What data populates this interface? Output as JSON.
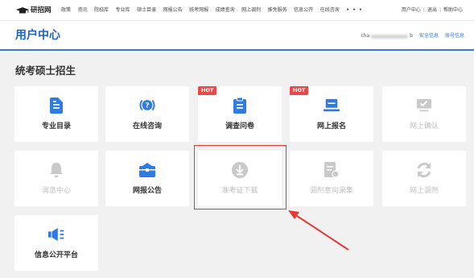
{
  "topnav": {
    "logo_text": "研招网",
    "links": [
      "政策",
      "资讯",
      "院校库",
      "专业库",
      "硕士目录",
      "网报公告",
      "统考网报",
      "成绩查询",
      "网上调剂",
      "推免服务",
      "信息公开",
      "在线咨询"
    ],
    "more": "• • •",
    "user_links": [
      "用户中心",
      "退出",
      "帮助中心"
    ],
    "separator": "|"
  },
  "header": {
    "title": "用户中心",
    "account_prefix": "cha",
    "account_suffix": "b",
    "link1": "安全信息",
    "link2": "账号信息"
  },
  "section": {
    "title": "统考硕士招生"
  },
  "cards": [
    {
      "label": "专业目录",
      "icon": "document-icon",
      "enabled": true,
      "hot": false
    },
    {
      "label": "在线咨询",
      "icon": "help-chat-icon",
      "enabled": true,
      "hot": false
    },
    {
      "label": "调查问卷",
      "icon": "clipboard-icon",
      "enabled": true,
      "hot": true
    },
    {
      "label": "网上报名",
      "icon": "laptop-icon",
      "enabled": true,
      "hot": true
    },
    {
      "label": "网上确认",
      "icon": "confirm-screen-icon",
      "enabled": false,
      "hot": false
    },
    {
      "label": "消息中心",
      "icon": "bell-icon",
      "enabled": false,
      "hot": false
    },
    {
      "label": "网报公告",
      "icon": "briefcase-icon",
      "enabled": true,
      "hot": false
    },
    {
      "label": "准考证下载",
      "icon": "download-icon",
      "enabled": false,
      "hot": false
    },
    {
      "label": "调剂意向采集",
      "icon": "form-icon",
      "enabled": false,
      "hot": false
    },
    {
      "label": "网上调剂",
      "icon": "refresh-icon",
      "enabled": false,
      "hot": false
    },
    {
      "label": "信息公开平台",
      "icon": "megaphone-icon",
      "enabled": true,
      "hot": false
    }
  ],
  "hot_label": "HOT",
  "colors": {
    "accent": "#2f7be5",
    "title": "#1b62c8",
    "hot": "#e64b4b",
    "disabled_icon": "#c9c9c9",
    "highlight": "#e53935"
  }
}
